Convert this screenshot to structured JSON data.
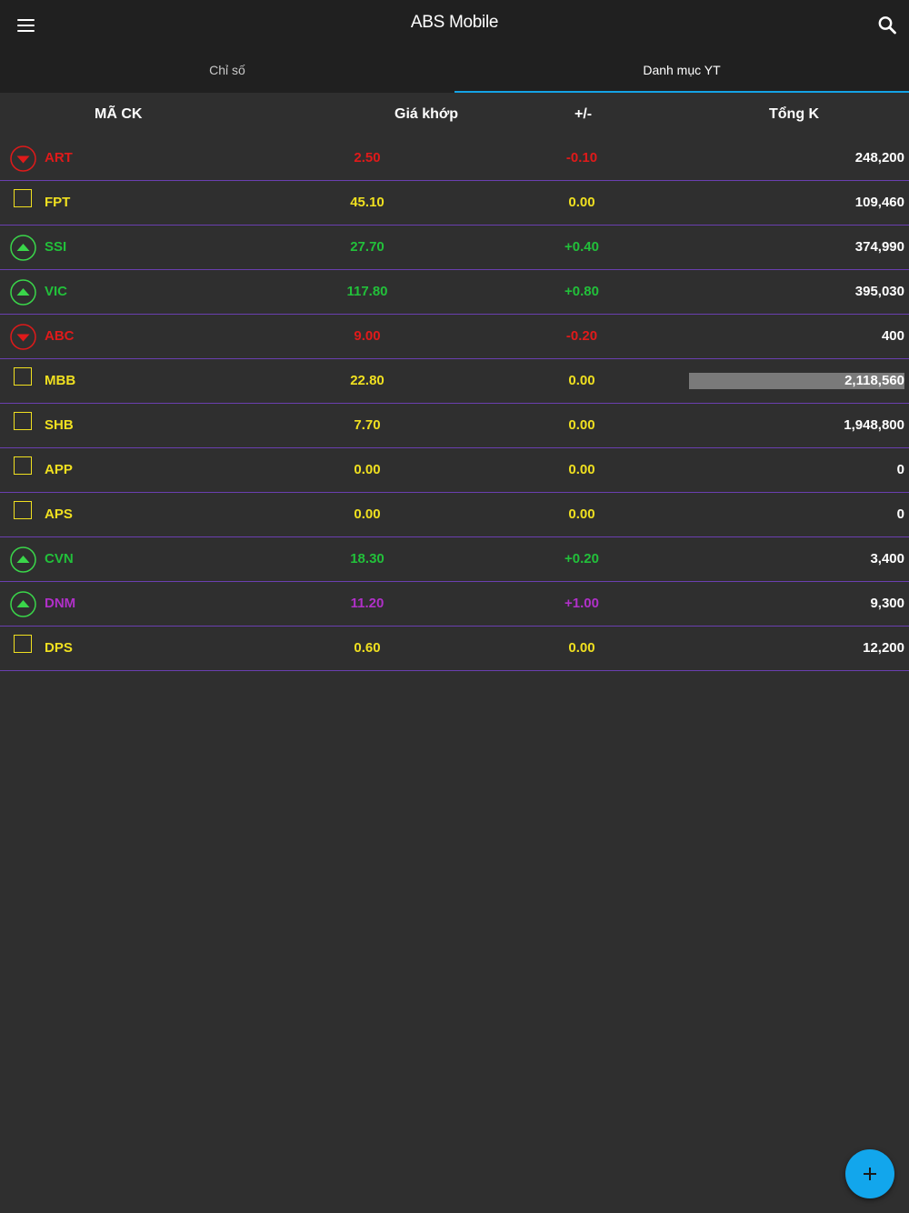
{
  "app": {
    "title": "ABS Mobile"
  },
  "icons": {
    "menu": "hamburger-menu-icon",
    "search": "search-icon",
    "add": "plus-icon"
  },
  "tabs": [
    {
      "label": "Chỉ số",
      "active": false
    },
    {
      "label": "Danh mục YT",
      "active": true
    }
  ],
  "table": {
    "headers": {
      "symbol": "MÃ CK",
      "price": "Giá khớp",
      "change": "+/-",
      "volume": "Tổng K"
    },
    "rows": [
      {
        "symbol": "ART",
        "price": "2.50",
        "change": "-0.10",
        "volume": "248,200",
        "status": "down",
        "highlighted": false
      },
      {
        "symbol": "FPT",
        "price": "45.10",
        "change": "0.00",
        "volume": "109,460",
        "status": "ref",
        "highlighted": false
      },
      {
        "symbol": "SSI",
        "price": "27.70",
        "change": "+0.40",
        "volume": "374,990",
        "status": "up",
        "highlighted": false
      },
      {
        "symbol": "VIC",
        "price": "117.80",
        "change": "+0.80",
        "volume": "395,030",
        "status": "up",
        "highlighted": false
      },
      {
        "symbol": "ABC",
        "price": "9.00",
        "change": "-0.20",
        "volume": "400",
        "status": "down",
        "highlighted": false
      },
      {
        "symbol": "MBB",
        "price": "22.80",
        "change": "0.00",
        "volume": "2,118,560",
        "status": "ref",
        "highlighted": true
      },
      {
        "symbol": "SHB",
        "price": "7.70",
        "change": "0.00",
        "volume": "1,948,800",
        "status": "ref",
        "highlighted": false
      },
      {
        "symbol": "APP",
        "price": "0.00",
        "change": "0.00",
        "volume": "0",
        "status": "ref",
        "highlighted": false
      },
      {
        "symbol": "APS",
        "price": "0.00",
        "change": "0.00",
        "volume": "0",
        "status": "ref",
        "highlighted": false
      },
      {
        "symbol": "CVN",
        "price": "18.30",
        "change": "+0.20",
        "volume": "3,400",
        "status": "up",
        "highlighted": false
      },
      {
        "symbol": "DNM",
        "price": "11.20",
        "change": "+1.00",
        "volume": "9,300",
        "status": "ceiling",
        "highlighted": false
      },
      {
        "symbol": "DPS",
        "price": "0.60",
        "change": "0.00",
        "volume": "12,200",
        "status": "ref",
        "highlighted": false
      }
    ]
  },
  "colors": {
    "up": "#22c03a",
    "down": "#e01a1a",
    "ref": "#f0e020",
    "ceiling": "#b030c8",
    "arrow_up": "#3ad64a",
    "accent": "#14a3e6",
    "row_divider": "#6a3fb0",
    "highlight": "#7a7a7a"
  }
}
